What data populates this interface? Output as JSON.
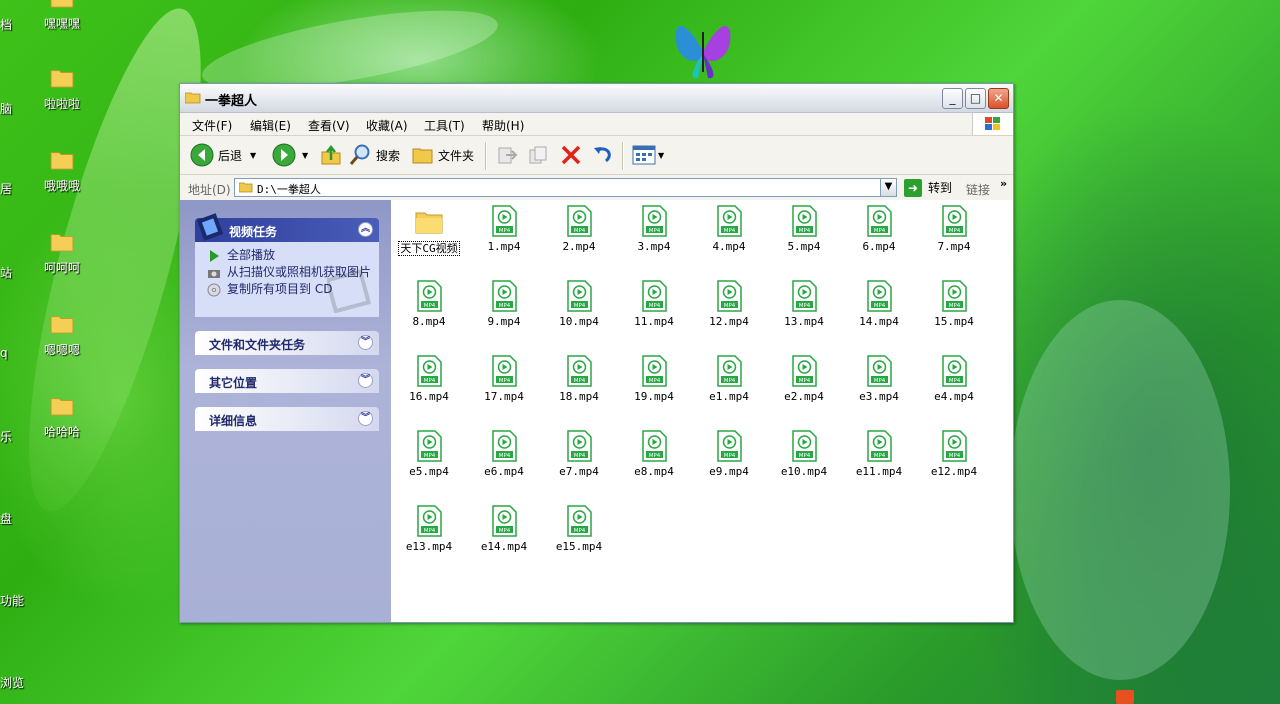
{
  "desktop": {
    "icons": [
      {
        "label": "嘿嘿嘿"
      },
      {
        "label": "啦啦啦"
      },
      {
        "label": "哦哦哦"
      },
      {
        "label": "呵呵呵"
      },
      {
        "label": "嗯嗯嗯"
      },
      {
        "label": "哈哈哈"
      }
    ],
    "edge_labels": [
      "档",
      "脑",
      "居",
      "站",
      "q",
      "乐",
      "盘",
      "功能",
      "浏览"
    ]
  },
  "window": {
    "title": "一拳超人",
    "controls": {
      "minimize": "_",
      "maximize": "□",
      "close": "✕"
    }
  },
  "menu": [
    "文件(F)",
    "编辑(E)",
    "查看(V)",
    "收藏(A)",
    "工具(T)",
    "帮助(H)"
  ],
  "toolbar": {
    "back": "后退",
    "search": "搜索",
    "folders": "文件夹"
  },
  "address": {
    "label": "地址(D)",
    "value": "D:\\一拳超人",
    "go": "转到",
    "links": "链接",
    "more": "»"
  },
  "taskpane": {
    "video_tasks": {
      "title": "视频任务",
      "items": [
        "全部播放",
        "从扫描仪或照相机获取图片",
        "复制所有项目到 CD"
      ]
    },
    "file_tasks": {
      "title": "文件和文件夹任务"
    },
    "other_places": {
      "title": "其它位置"
    },
    "details": {
      "title": "详细信息"
    }
  },
  "files": [
    {
      "name": "天下CG视频",
      "type": "folder"
    },
    {
      "name": "1.mp4",
      "type": "mp4"
    },
    {
      "name": "2.mp4",
      "type": "mp4"
    },
    {
      "name": "3.mp4",
      "type": "mp4"
    },
    {
      "name": "4.mp4",
      "type": "mp4"
    },
    {
      "name": "5.mp4",
      "type": "mp4"
    },
    {
      "name": "6.mp4",
      "type": "mp4"
    },
    {
      "name": "7.mp4",
      "type": "mp4"
    },
    {
      "name": "8.mp4",
      "type": "mp4"
    },
    {
      "name": "9.mp4",
      "type": "mp4"
    },
    {
      "name": "10.mp4",
      "type": "mp4"
    },
    {
      "name": "11.mp4",
      "type": "mp4"
    },
    {
      "name": "12.mp4",
      "type": "mp4"
    },
    {
      "name": "13.mp4",
      "type": "mp4"
    },
    {
      "name": "14.mp4",
      "type": "mp4"
    },
    {
      "name": "15.mp4",
      "type": "mp4"
    },
    {
      "name": "16.mp4",
      "type": "mp4"
    },
    {
      "name": "17.mp4",
      "type": "mp4"
    },
    {
      "name": "18.mp4",
      "type": "mp4"
    },
    {
      "name": "19.mp4",
      "type": "mp4"
    },
    {
      "name": "e1.mp4",
      "type": "mp4"
    },
    {
      "name": "e2.mp4",
      "type": "mp4"
    },
    {
      "name": "e3.mp4",
      "type": "mp4"
    },
    {
      "name": "e4.mp4",
      "type": "mp4"
    },
    {
      "name": "e5.mp4",
      "type": "mp4"
    },
    {
      "name": "e6.mp4",
      "type": "mp4"
    },
    {
      "name": "e7.mp4",
      "type": "mp4"
    },
    {
      "name": "e8.mp4",
      "type": "mp4"
    },
    {
      "name": "e9.mp4",
      "type": "mp4"
    },
    {
      "name": "e10.mp4",
      "type": "mp4"
    },
    {
      "name": "e11.mp4",
      "type": "mp4"
    },
    {
      "name": "e12.mp4",
      "type": "mp4"
    },
    {
      "name": "e13.mp4",
      "type": "mp4"
    },
    {
      "name": "e14.mp4",
      "type": "mp4"
    },
    {
      "name": "e15.mp4",
      "type": "mp4"
    }
  ],
  "mp4_badge": "MP4",
  "colors": {
    "desktop_green": "#3fc21a",
    "mp4_icon_green": "#29a745",
    "taskpane_blue": "#2e3f9c"
  }
}
